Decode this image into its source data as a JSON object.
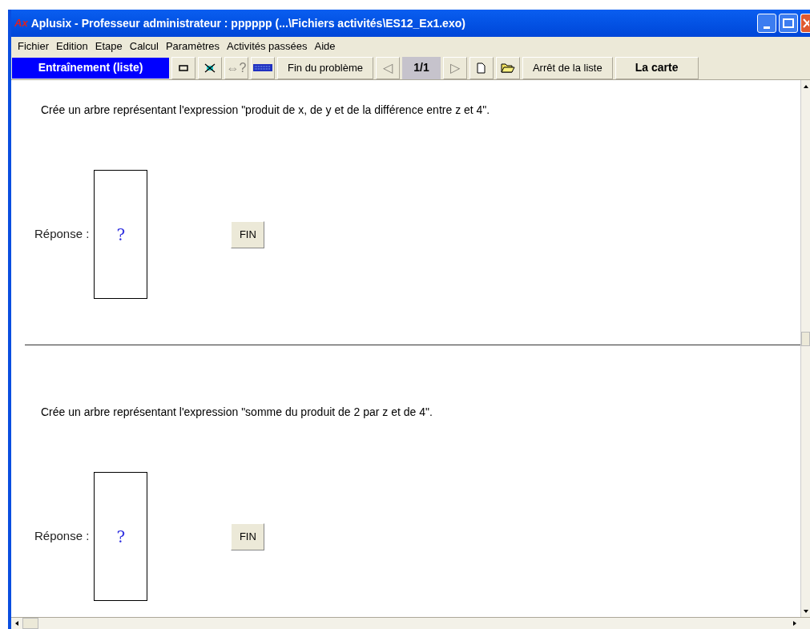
{
  "window": {
    "title": "Aplusix - Professeur administrateur : pppppp  (...\\Fichiers activités\\ES12_Ex1.exo)",
    "logo": "Ax"
  },
  "menu": [
    "Fichier",
    "Edition",
    "Etape",
    "Calcul",
    "Paramètres",
    "Activités passées",
    "Aide"
  ],
  "toolbar": [
    {
      "kind": "mode",
      "label": "Entraînement (liste)"
    },
    {
      "kind": "icon",
      "disabled": false
    },
    {
      "kind": "icon",
      "disabled": false
    },
    {
      "kind": "icon",
      "label": "⇔?",
      "disabled": true
    },
    {
      "kind": "icon",
      "disabled": false
    },
    {
      "kind": "text",
      "label": "Fin du problème"
    },
    {
      "kind": "icon",
      "label": "◁",
      "disabled": true
    },
    {
      "kind": "page",
      "label": "1/1"
    },
    {
      "kind": "icon",
      "label": "▷",
      "disabled": true
    },
    {
      "kind": "icon",
      "disabled": false
    },
    {
      "kind": "icon",
      "disabled": false
    },
    {
      "kind": "text",
      "label": "Arrêt de la liste"
    },
    {
      "kind": "strong",
      "label": "La carte"
    }
  ],
  "problems": [
    {
      "prompt": "Crée un arbre représentant l'expression \"produit de x, de y et de la différence entre z et 4\".",
      "answer_label": "Réponse :",
      "answer_value": "?",
      "button": "FIN"
    },
    {
      "prompt": "Crée un arbre représentant l'expression \"somme du produit de 2 par z et de 4\".",
      "answer_label": "Réponse :",
      "answer_value": "?",
      "button": "FIN"
    }
  ]
}
